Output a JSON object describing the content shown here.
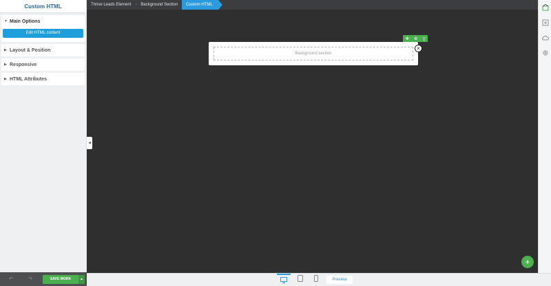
{
  "sidebar": {
    "title": "Custom HTML",
    "panels": [
      {
        "label": "Main Options",
        "open": true
      },
      {
        "label": "Layout & Position",
        "open": false
      },
      {
        "label": "Responsive",
        "open": false
      },
      {
        "label": "HTML Attributes",
        "open": false
      }
    ],
    "edit_button_label": "Edit HTML content",
    "save_label": "SAVE WORK"
  },
  "breadcrumb": {
    "items": [
      "Thrive Leads Element",
      "Background Section",
      "Custom HTML"
    ]
  },
  "canvas": {
    "section_placeholder": "Background section"
  },
  "bottom_bar": {
    "preview_label": "Preview"
  },
  "colors": {
    "accent_blue": "#2b9be0",
    "accent_green": "#4caf50",
    "canvas_bg": "#2f2f2f"
  },
  "icons": {
    "toolbar": [
      "move-icon",
      "settings-icon",
      "delete-icon"
    ],
    "right_rail": [
      "inbox-icon",
      "plus-square-icon",
      "cloud-icon",
      "gear-icon"
    ],
    "devices": [
      "desktop-icon",
      "tablet-icon",
      "mobile-icon"
    ]
  }
}
